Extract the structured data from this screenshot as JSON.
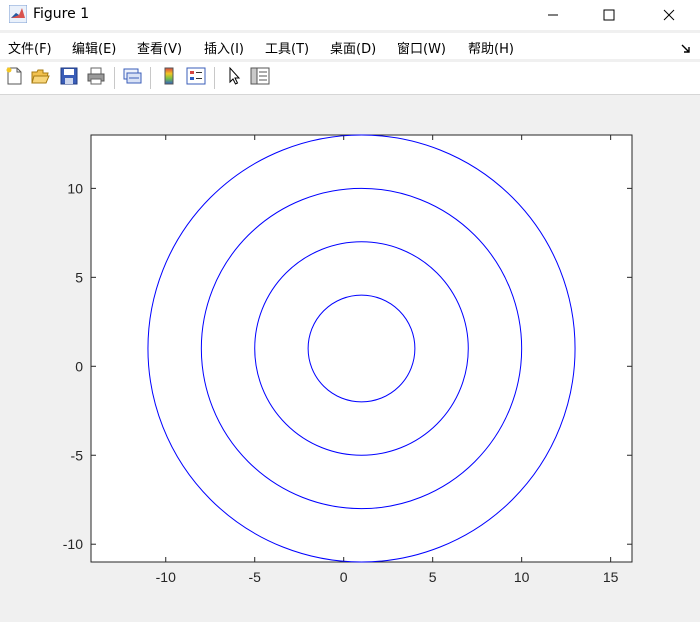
{
  "window": {
    "title": "Figure 1",
    "icons": {
      "app": "matlab-logo-icon",
      "minimize": "minimize-icon",
      "maximize": "maximize-icon",
      "close": "close-icon"
    }
  },
  "menu": {
    "items": [
      "文件(F)",
      "编辑(E)",
      "查看(V)",
      "插入(I)",
      "工具(T)",
      "桌面(D)",
      "窗口(W)",
      "帮助(H)"
    ],
    "dock_icon": "dock-arrow-icon"
  },
  "toolbar": {
    "buttons": [
      "new-figure-icon",
      "open-file-icon",
      "save-icon",
      "print-icon",
      "link-plot-icon",
      "colorbar-icon",
      "legend-icon",
      "edit-plot-pointer-icon",
      "property-inspector-icon"
    ]
  },
  "chart_data": {
    "type": "line",
    "title": "",
    "xlabel": "",
    "ylabel": "",
    "xlim": [
      -14.2,
      16.2
    ],
    "ylim": [
      -11,
      13
    ],
    "xticks": [
      -10,
      -5,
      0,
      5,
      10,
      15
    ],
    "yticks": [
      -10,
      -5,
      0,
      5,
      10
    ],
    "xtick_labels": [
      "-10",
      "-5",
      "0",
      "5",
      "10",
      "15"
    ],
    "ytick_labels": [
      "-10",
      "-5",
      "0",
      "5",
      "10"
    ],
    "grid": false,
    "line_color": "#0000ff",
    "series": [
      {
        "center": [
          1,
          1
        ],
        "radius": 3
      },
      {
        "center": [
          1,
          1
        ],
        "radius": 6
      },
      {
        "center": [
          1,
          1
        ],
        "radius": 9
      },
      {
        "center": [
          1,
          1
        ],
        "radius": 12
      }
    ]
  }
}
